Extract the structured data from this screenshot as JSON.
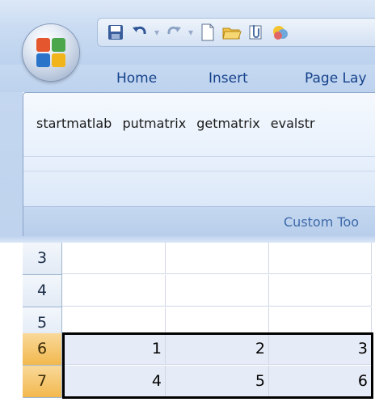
{
  "ribbon": {
    "tabs": [
      "Home",
      "Insert",
      "Page Lay"
    ],
    "commands": [
      "startmatlab",
      "putmatrix",
      "getmatrix",
      "evalstr"
    ],
    "group_label": "Custom Too"
  },
  "sheet": {
    "rows": [
      {
        "header": "3",
        "cells": [
          "",
          "",
          ""
        ],
        "selected": false
      },
      {
        "header": "4",
        "cells": [
          "",
          "",
          ""
        ],
        "selected": false
      },
      {
        "header": "5",
        "cells": [
          "",
          "",
          ""
        ],
        "selected": false
      },
      {
        "header": "6",
        "cells": [
          "1",
          "2",
          "3"
        ],
        "selected": true
      },
      {
        "header": "7",
        "cells": [
          "4",
          "5",
          "6"
        ],
        "selected": true
      }
    ]
  },
  "colors": {
    "accent_text": "#15428b",
    "selected_row_header": "#f2b84d",
    "selection_fill": "#e6ecf7"
  }
}
